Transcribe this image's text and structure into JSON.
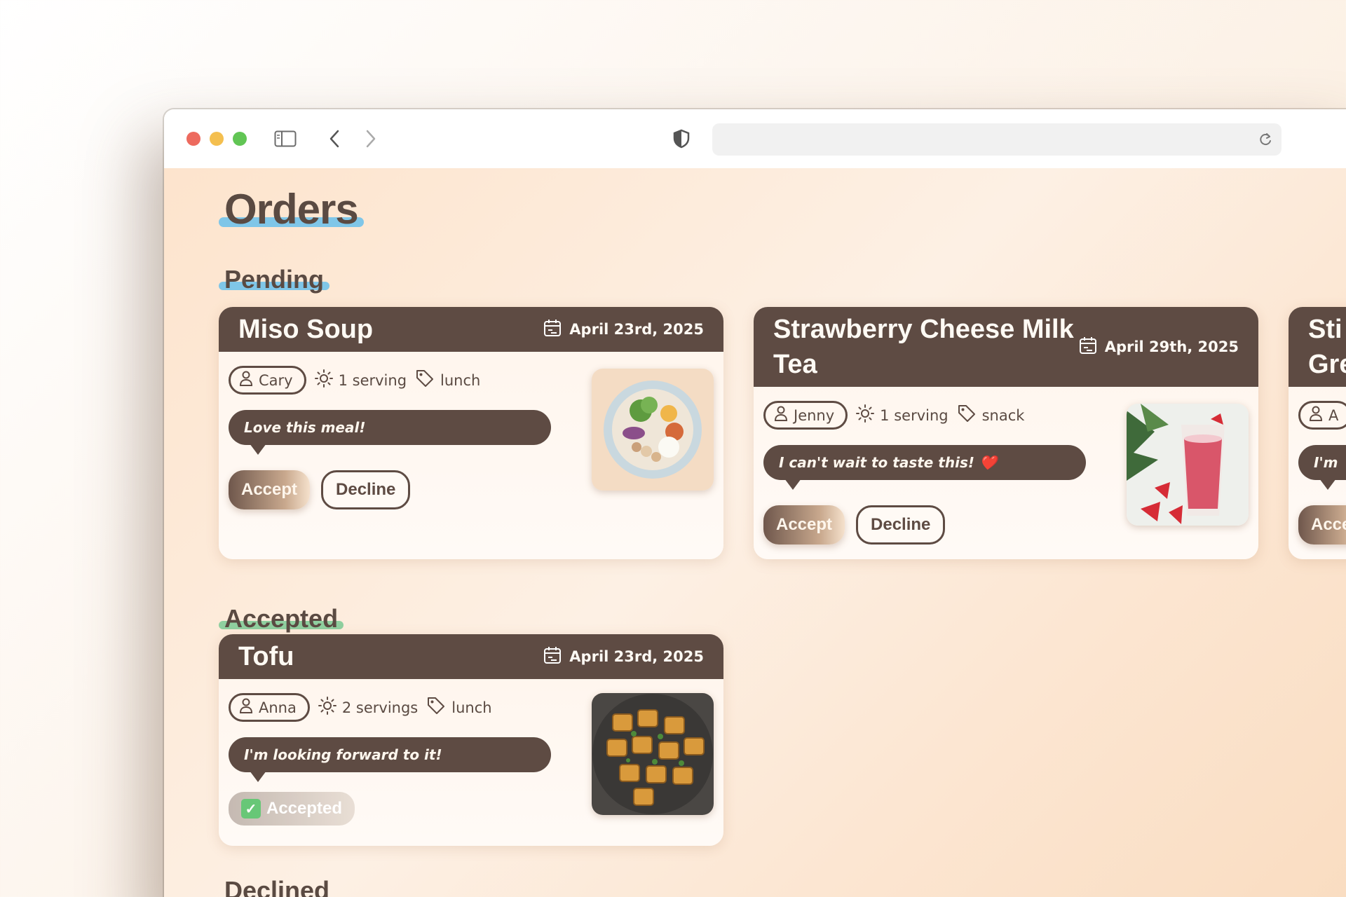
{
  "browser": {
    "address": "",
    "icons": [
      "sidebar-toggle-icon",
      "back-icon",
      "forward-icon",
      "shield-icon",
      "reload-icon"
    ]
  },
  "page": {
    "title": "Orders",
    "sections": {
      "pending": "Pending",
      "accepted": "Accepted",
      "declined": "Declined"
    }
  },
  "pending": [
    {
      "name": "Miso Soup",
      "date": "April 23rd, 2025",
      "user": "Cary",
      "servings": "1 serving",
      "category": "lunch",
      "note": "Love this meal!",
      "accept_label": "Accept",
      "decline_label": "Decline"
    },
    {
      "name": "Strawberry Cheese Milk Tea",
      "date": "April 29th, 2025",
      "user": "Jenny",
      "servings": "1 serving",
      "category": "snack",
      "note": "I can't wait to taste this! ❤️",
      "accept_label": "Accept",
      "decline_label": "Decline"
    },
    {
      "name": "Sti Gre",
      "user": "A",
      "note": "I'm",
      "accept_label": "Acce"
    }
  ],
  "accepted": [
    {
      "name": "Tofu",
      "date": "April 23rd, 2025",
      "user": "Anna",
      "servings": "2 servings",
      "category": "lunch",
      "note": "I'm looking forward to it!",
      "status_label": "Accepted"
    }
  ],
  "colors": {
    "header": "#5e4b43",
    "pending_highlight": "#7fc6e8",
    "accepted_highlight": "#8fcf9f"
  }
}
